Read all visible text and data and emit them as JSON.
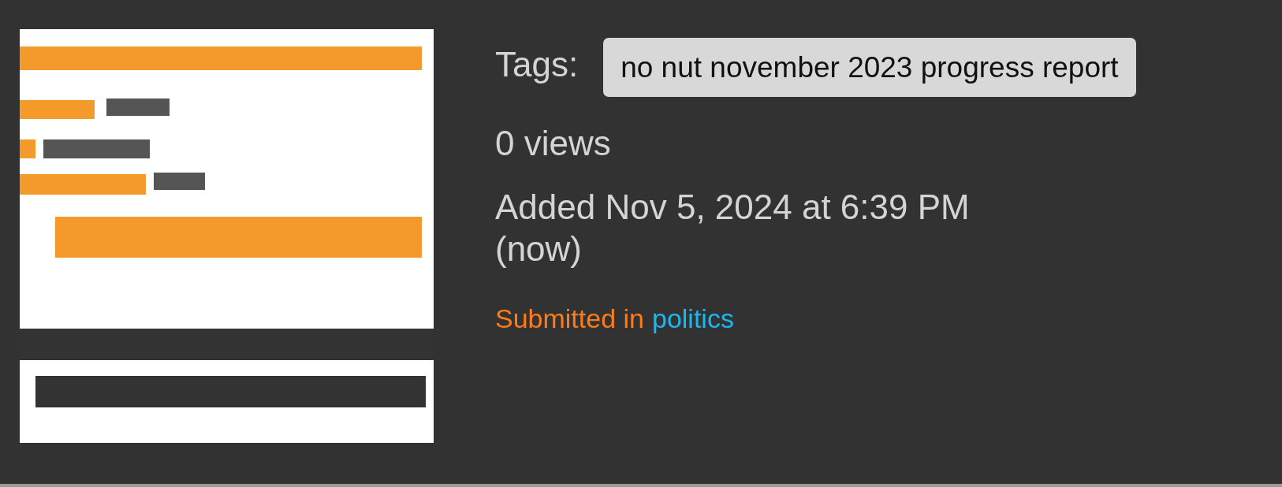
{
  "tags_label": "Tags:",
  "tags": [
    {
      "label": "no nut november 2023 progress report"
    }
  ],
  "views": "0 views",
  "added": "Added Nov 5, 2024 at 6:39 PM",
  "added_relative": "(now)",
  "submission": {
    "prefix": "Submitted in",
    "stream": "politics"
  }
}
